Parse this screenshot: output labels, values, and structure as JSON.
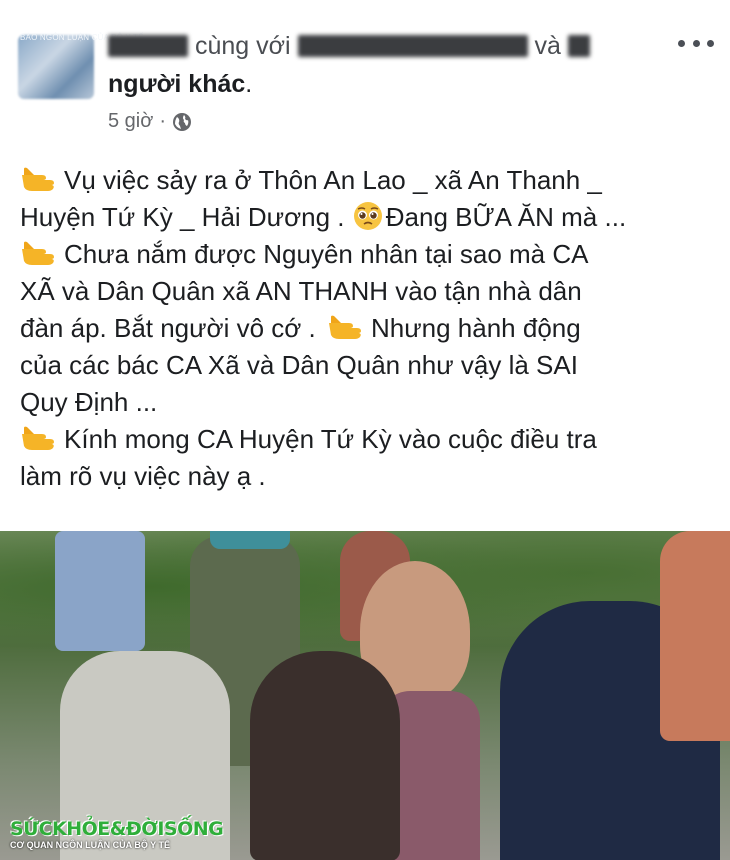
{
  "header": {
    "avatar_caption": "BÁO NGÔN LUẬN CỦA BỘ Y TẾ",
    "title_with": "cùng với",
    "title_and": "và",
    "title_others": "người khác",
    "title_end": ".",
    "timestamp": "5 giờ",
    "separator": "·",
    "privacy_icon": "globe-icon",
    "more_icon": "more-horizontal-icon"
  },
  "post": {
    "line1": "Vụ việc sảy ra ở Thôn An Lao _ xã An Thanh _",
    "line2a": "Huyện Tứ Kỳ _ Hải Dương .",
    "line2b": "Đang BỮA ĂN mà ...",
    "line3": "Chưa nắm được Nguyên nhân tại sao mà CA",
    "line4": "XÃ và Dân Quân xã AN THANH vào tận nhà dân",
    "line5a": "đàn áp. Bắt người vô cớ .",
    "line5b": "Nhưng hành động",
    "line6": "của các bác CA Xã và Dân Quân như vậy là SAI",
    "line7": "Quy Định ...",
    "line8": "Kính mong CA Huyện Tứ Kỳ vào cuộc điều tra",
    "line9": "làm rõ vụ việc này ạ ."
  },
  "photo": {
    "watermark_main": "SỨCKHỎE&ĐỜISỐNG",
    "watermark_sub": "CƠ QUAN NGÔN LUẬN CỦA BỘ Y TẾ"
  },
  "colors": {
    "text": "#1c1e21",
    "meta": "#65676b",
    "hand_emoji": "#f5b427",
    "watermark": "#2fae3a"
  }
}
